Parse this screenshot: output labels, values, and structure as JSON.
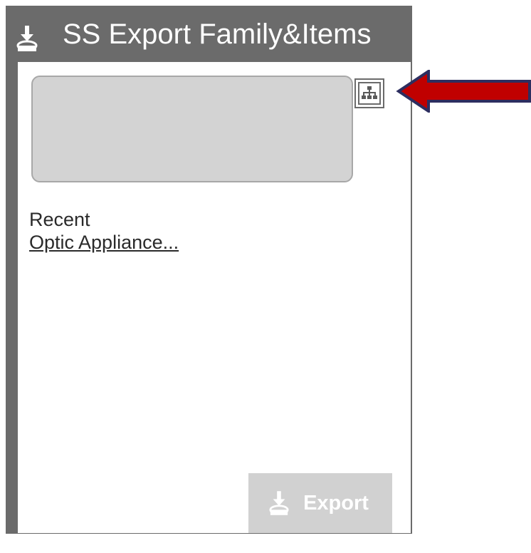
{
  "panel": {
    "title": "SS Export Family&Items",
    "icons": {
      "header": "download-person-icon",
      "hierarchy": "hierarchy-tree-icon",
      "export": "download-person-icon",
      "callout": "red-arrow"
    }
  },
  "recent": {
    "label": "Recent",
    "link_text": "Optic Appliance..."
  },
  "export_button": {
    "label": "Export"
  },
  "colors": {
    "header_bg": "#6b6b6b",
    "selector_bg": "#d3d3d3",
    "export_bg": "#d1d1d1",
    "arrow": "#c00000",
    "arrow_outline": "#2d2e60"
  }
}
